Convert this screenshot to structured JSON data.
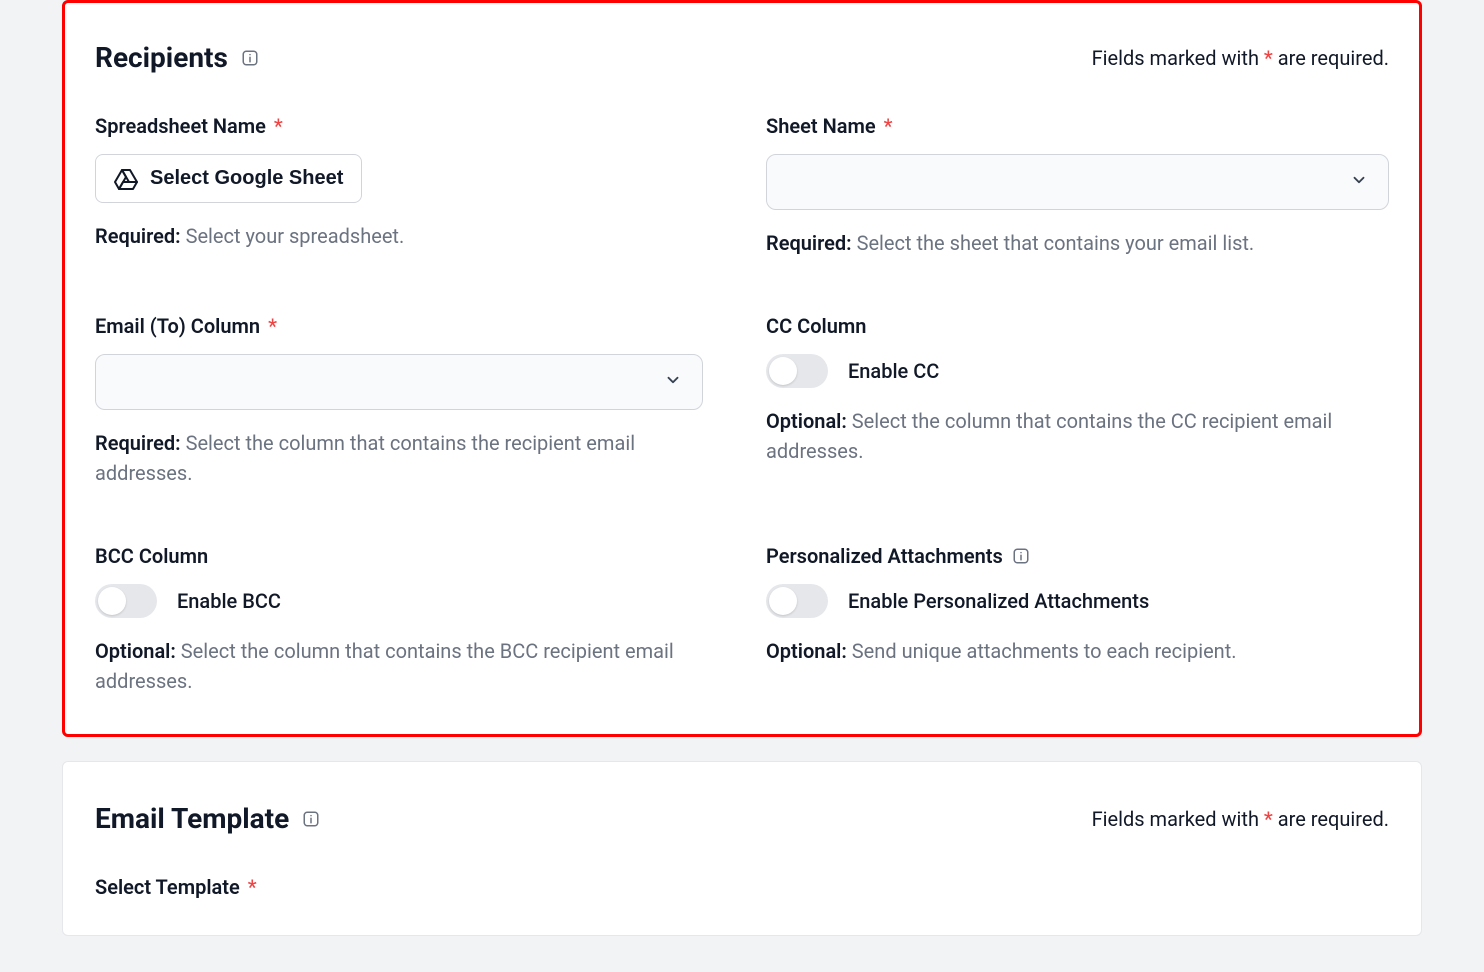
{
  "required_note_prefix": "Fields marked with ",
  "required_note_suffix": " are required.",
  "asterisk": "*",
  "recipients": {
    "title": "Recipients",
    "spreadsheet_name": {
      "label": "Spreadsheet Name",
      "button": "Select Google Sheet",
      "help_prefix": "Required:",
      "help_text": " Select your spreadsheet."
    },
    "sheet_name": {
      "label": "Sheet Name",
      "help_prefix": "Required:",
      "help_text": " Select the sheet that contains your email list."
    },
    "email_to": {
      "label": "Email (To) Column",
      "help_prefix": "Required:",
      "help_text": " Select the column that contains the recipient email addresses."
    },
    "cc": {
      "label": "CC Column",
      "toggle_label": "Enable CC",
      "help_prefix": "Optional:",
      "help_text": " Select the column that contains the CC recipient email addresses."
    },
    "bcc": {
      "label": "BCC Column",
      "toggle_label": "Enable BCC",
      "help_prefix": "Optional:",
      "help_text": " Select the column that contains the BCC recipient email addresses."
    },
    "attachments": {
      "label": "Personalized Attachments",
      "toggle_label": "Enable Personalized Attachments",
      "help_prefix": "Optional:",
      "help_text": " Send unique attachments to each recipient."
    }
  },
  "email_template": {
    "title": "Email Template",
    "select_template": {
      "label": "Select Template"
    }
  }
}
